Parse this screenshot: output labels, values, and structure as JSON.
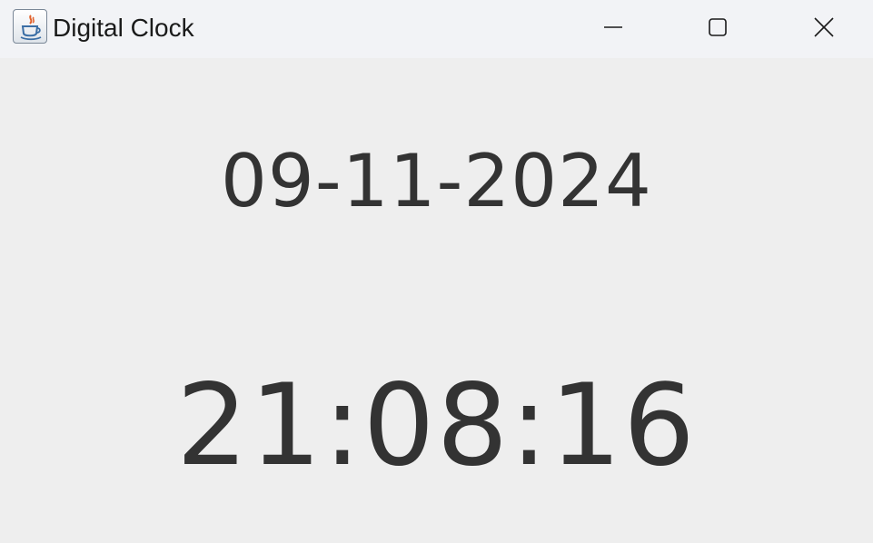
{
  "window": {
    "title": "Digital Clock",
    "icon": "java-cup-icon",
    "controls": {
      "minimize": "minimize-icon",
      "maximize": "maximize-icon",
      "close": "close-icon"
    }
  },
  "clock": {
    "date": "09-11-2024",
    "time": "21:08:16"
  },
  "colors": {
    "titlebar_bg": "#f2f3f6",
    "content_bg": "#eeeeee",
    "text": "#333333"
  }
}
